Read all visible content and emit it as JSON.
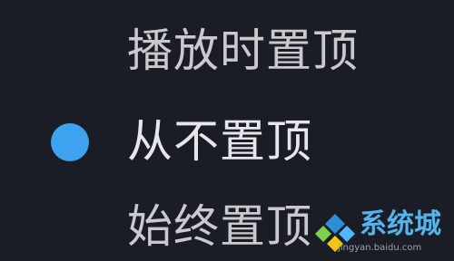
{
  "menu": {
    "options": [
      {
        "label": "播放时置顶",
        "selected": false
      },
      {
        "label": "从不置顶",
        "selected": true
      },
      {
        "label": "始终置顶",
        "selected": false
      }
    ]
  },
  "watermark": {
    "title": "系统城",
    "url": "jingyan.baidu.com",
    "colors": [
      "#2a8fd6",
      "#4db8ff",
      "#7fd04a",
      "#f0c419"
    ]
  },
  "colors": {
    "background": "#1b1d26",
    "accent": "#3ea2ee",
    "text": "#c9cacd",
    "selected_text": "#e6e7ea"
  }
}
